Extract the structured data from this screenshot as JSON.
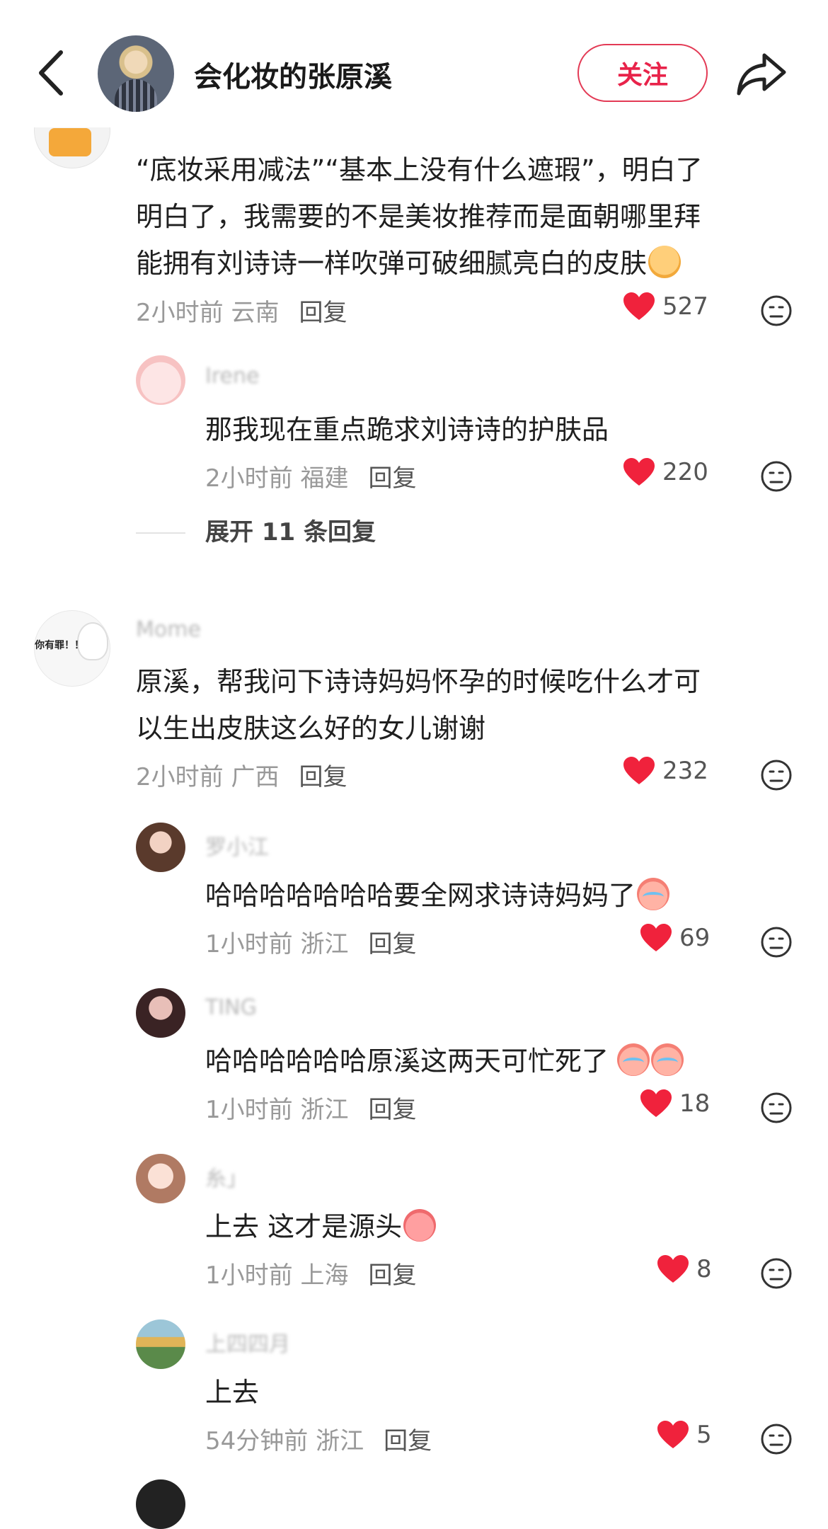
{
  "header": {
    "title": "会化妆的张原溪",
    "follow_label": "关注"
  },
  "comments": [
    {
      "text_lines": [
        "“底妆采用减法”“基本上没有什么遮瑕”，明白了",
        "明白了，我需要的不是美妆推荐而是面朝哪里拜",
        "能拥有刘诗诗一样吹弹可破细腻亮白的皮肤"
      ],
      "time_location": "2小时前 云南",
      "reply_label": "回复",
      "likes": "527"
    },
    {
      "username": "Irene",
      "text": "那我现在重点跪求刘诗诗的护肤品",
      "time_location": "2小时前 福建",
      "reply_label": "回复",
      "likes": "220"
    },
    {
      "expand_label": "展开 11 条回复"
    },
    {
      "username": "Mome",
      "avatar_text": "你有罪！！",
      "text_lines": [
        "原溪，帮我问下诗诗妈妈怀孕的时候吃什么才可",
        "以生出皮肤这么好的女儿谢谢"
      ],
      "time_location": "2小时前 广西",
      "reply_label": "回复",
      "likes": "232"
    },
    {
      "username": "罗小江",
      "text": "哈哈哈哈哈哈哈要全网求诗诗妈妈了",
      "time_location": "1小时前 浙江",
      "reply_label": "回复",
      "likes": "69"
    },
    {
      "username": "TING",
      "text": "哈哈哈哈哈哈原溪这两天可忙死了",
      "time_location": "1小时前 浙江",
      "reply_label": "回复",
      "likes": "18"
    },
    {
      "username": "糸」",
      "text": "上去 这才是源头",
      "time_location": "1小时前 上海",
      "reply_label": "回复",
      "likes": "8"
    },
    {
      "username": "上四四月",
      "text": "上去",
      "time_location": "54分钟前 浙江",
      "reply_label": "回复",
      "likes": "5"
    }
  ],
  "colors": {
    "accent": "#e8234a",
    "heart": "#f0223c",
    "muted_text": "#999999"
  }
}
